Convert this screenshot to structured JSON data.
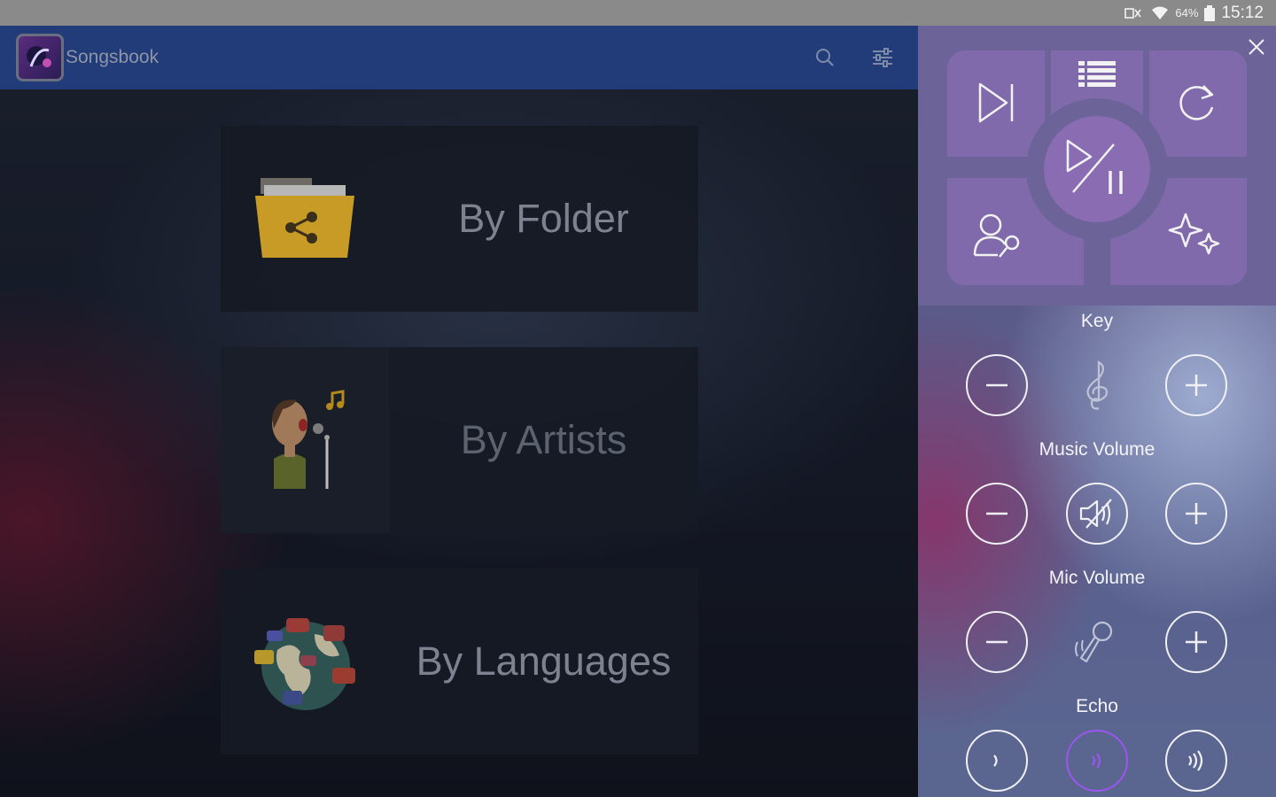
{
  "status_bar": {
    "battery": "64%",
    "time": "15:12"
  },
  "app": {
    "title": "Songsbook",
    "icons": {
      "search": "search-icon",
      "filter": "filter-sliders-icon",
      "logo": "songsbook-logo-icon"
    },
    "categories": [
      {
        "label": "By Folder",
        "icon": "shared-folder-icon"
      },
      {
        "label": "By Artists",
        "icon": "singer-icon"
      },
      {
        "label": "By Languages",
        "icon": "globe-chat-icon"
      }
    ]
  },
  "panel": {
    "controls": {
      "next": "skip-next-icon",
      "list": "playlist-grid-icon",
      "repeat": "repeat-icon",
      "play_pause": "play-pause-icon",
      "vocal": "vocal-mic-user-icon",
      "effects": "sparkle-effects-icon"
    },
    "key_label": "Key",
    "music_volume_label": "Music Volume",
    "mic_volume_label": "Mic Volume",
    "echo_label": "Echo",
    "echo_levels": [
      "low",
      "medium",
      "high"
    ],
    "echo_selected": "medium",
    "accent_color": "#9b55f0"
  }
}
